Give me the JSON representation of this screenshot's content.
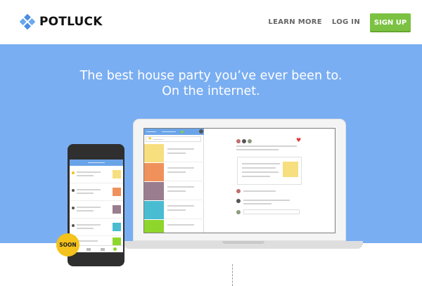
{
  "header": {
    "logo_text": "POTLUCK",
    "nav": [
      "LEARN MORE",
      "LOG IN"
    ],
    "signup_label": "SIGN UP"
  },
  "hero": {
    "headline_line1": "The best house party you’ve ever been to.",
    "headline_line2": "On the internet.",
    "badge": "SOON"
  },
  "colors": {
    "hero_bg": "#7aaef2",
    "signup": "#7cc242",
    "badge": "#f4c21b",
    "logo": "#4a8ee0",
    "swatches": [
      "#f7de7e",
      "#f0915c",
      "#9a7d8e",
      "#49bcd2",
      "#8ed62b"
    ]
  },
  "icons": [
    "logo-icon",
    "heart-icon",
    "star-icon"
  ]
}
